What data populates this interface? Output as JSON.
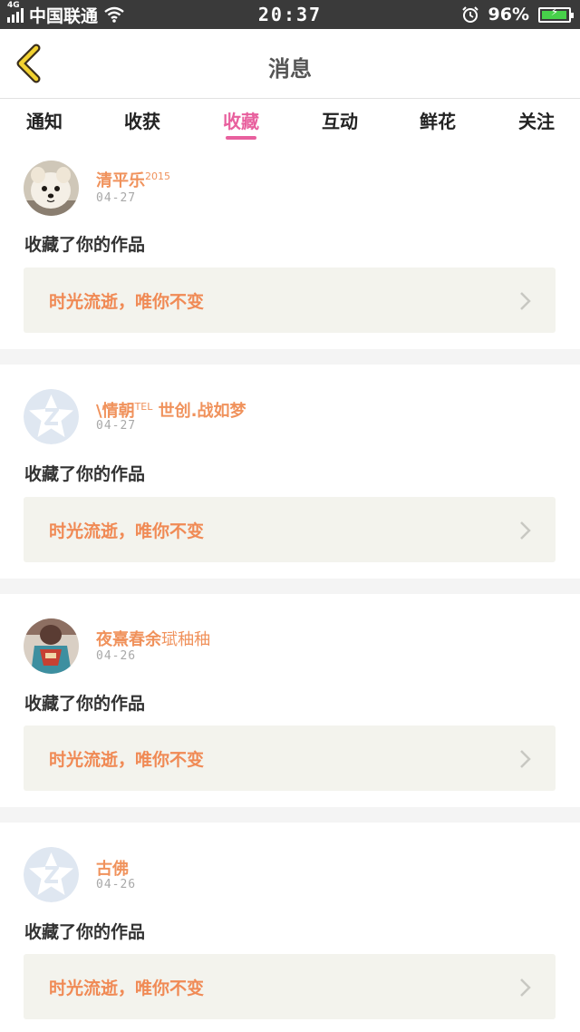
{
  "status_bar": {
    "network": "4G",
    "carrier": "中国联通",
    "time": "20:37",
    "battery": "96%",
    "battery_level": 0.96
  },
  "header": {
    "title": "消息"
  },
  "tabs": [
    {
      "label": "通知",
      "active": false
    },
    {
      "label": "收获",
      "active": false
    },
    {
      "label": "收藏",
      "active": true
    },
    {
      "label": "互动",
      "active": false
    },
    {
      "label": "鲜花",
      "active": false
    },
    {
      "label": "关注",
      "active": false
    }
  ],
  "items": [
    {
      "user": "清平乐",
      "user_sup": "2015",
      "date": "04-27",
      "action": "收藏了你的作品",
      "work": "时光流逝，唯你不变",
      "avatar": "dog-photo"
    },
    {
      "user": "\\情朝",
      "user_sup": "TEL",
      "user_suffix": "世创.战如梦",
      "date": "04-27",
      "action": "收藏了你的作品",
      "work": "时光流逝，唯你不变",
      "avatar": "default-qq-avatar"
    },
    {
      "user": "夜熹春余",
      "user_suffix": "珷秞秞",
      "date": "04-26",
      "action": "收藏了你的作品",
      "work": "时光流逝，唯你不变",
      "avatar": "person-photo"
    },
    {
      "user": "古佛",
      "date": "04-26",
      "action": "收藏了你的作品",
      "work": "时光流逝，唯你不变",
      "avatar": "default-qq-avatar"
    }
  ],
  "colors": {
    "accent": "#e8609e",
    "username": "#f0925c",
    "work_title": "#f08a55",
    "work_box": "#f3f3ed",
    "status_bar": "#3a3a3a"
  }
}
